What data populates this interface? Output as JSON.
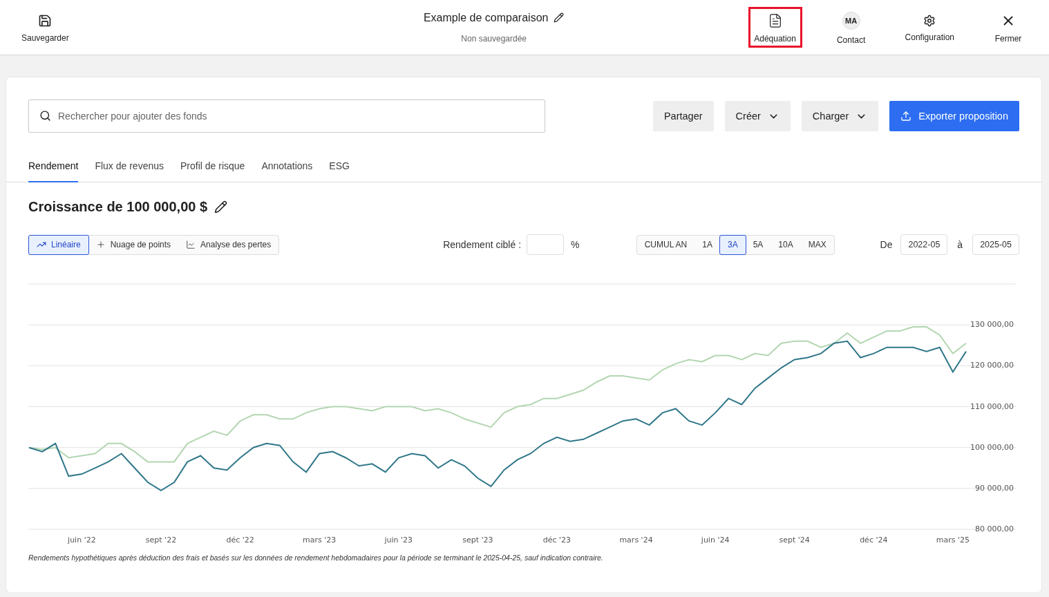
{
  "header": {
    "save": {
      "label": "Sauvegarder"
    },
    "title": "Example de comparaison",
    "status": "Non sauvegardée",
    "actions": [
      {
        "kind": "document",
        "label": "Adéquation",
        "highlighted": true
      },
      {
        "kind": "avatar",
        "initials": "MA",
        "label": "Contact",
        "highlighted": false
      },
      {
        "kind": "gear",
        "label": "Configuration",
        "highlighted": false
      },
      {
        "kind": "close",
        "label": "Fermer",
        "highlighted": false
      }
    ]
  },
  "toolbar": {
    "search": {
      "placeholder": "Rechercher pour ajouter des fonds"
    },
    "buttons": [
      {
        "kind": "plain",
        "label": "Partager"
      },
      {
        "kind": "dropdown",
        "label": "Créer"
      },
      {
        "kind": "dropdown",
        "label": "Charger"
      },
      {
        "kind": "primary",
        "label": "Exporter proposition"
      }
    ]
  },
  "tabs": [
    {
      "label": "Rendement",
      "selected": true
    },
    {
      "label": "Flux de revenus",
      "selected": false
    },
    {
      "label": "Profil de risque",
      "selected": false
    },
    {
      "label": "Annotations",
      "selected": false
    },
    {
      "label": "ESG",
      "selected": false
    }
  ],
  "section_title": "Croissance de 100 000,00 $",
  "views": [
    {
      "kind": "line",
      "label": "Linéaire",
      "selected": true
    },
    {
      "kind": "scatter",
      "label": "Nuage de points",
      "selected": false
    },
    {
      "kind": "loss",
      "label": "Analyse des pertes",
      "selected": false
    }
  ],
  "target": {
    "label": "Rendement ciblé :",
    "unit": "%"
  },
  "periods": [
    {
      "label": "CUMUL AN",
      "selected": false
    },
    {
      "label": "1A",
      "selected": false
    },
    {
      "label": "3A",
      "selected": true
    },
    {
      "label": "5A",
      "selected": false
    },
    {
      "label": "10A",
      "selected": false
    },
    {
      "label": "MAX",
      "selected": false
    }
  ],
  "range": {
    "from_label": "De",
    "from": "2022-05",
    "to_label": "à",
    "to": "2025-05"
  },
  "chart_data": {
    "type": "line",
    "categories": [
      null,
      null,
      null,
      null,
      "juin '22",
      null,
      null,
      null,
      null,
      null,
      "sept '22",
      null,
      null,
      null,
      null,
      null,
      "déc '22",
      null,
      null,
      null,
      null,
      null,
      "mars '23",
      null,
      null,
      null,
      null,
      null,
      "juin '23",
      null,
      null,
      null,
      null,
      null,
      "sept '23",
      null,
      null,
      null,
      null,
      null,
      "déc '23",
      null,
      null,
      null,
      null,
      null,
      "mars '24",
      null,
      null,
      null,
      null,
      null,
      "juin '24",
      null,
      null,
      null,
      null,
      null,
      "sept '24",
      null,
      null,
      null,
      null,
      null,
      "déc '24",
      null,
      null,
      null,
      null,
      null,
      "mars '25",
      null
    ],
    "series": [
      {
        "color": "#b3d6b0",
        "values": [
          100000,
          99500,
          100000,
          97500,
          98000,
          98500,
          101000,
          101000,
          99000,
          96500,
          96500,
          96500,
          101000,
          102500,
          104000,
          103000,
          106500,
          108000,
          108000,
          107000,
          107000,
          108500,
          109500,
          110000,
          110000,
          109500,
          109000,
          110000,
          110000,
          110000,
          109000,
          109500,
          108500,
          107000,
          106000,
          105000,
          108500,
          110000,
          110500,
          112000,
          112000,
          113000,
          114000,
          116000,
          117500,
          117500,
          117000,
          116500,
          119000,
          120500,
          121500,
          121000,
          122500,
          122500,
          121500,
          123000,
          122500,
          125500,
          126000,
          126000,
          124500,
          125500,
          128000,
          125500,
          127000,
          128500,
          128500,
          129500,
          129500,
          127500,
          123000,
          125500
        ]
      },
      {
        "color": "#2f7789",
        "values": [
          100000,
          99000,
          101000,
          93000,
          93500,
          95000,
          96500,
          98500,
          95000,
          91500,
          89500,
          91500,
          96500,
          98000,
          95000,
          94500,
          97500,
          100000,
          101000,
          100500,
          96500,
          94000,
          98500,
          99000,
          97500,
          95500,
          96000,
          94000,
          97500,
          98500,
          98000,
          95000,
          97000,
          95500,
          92500,
          90500,
          94500,
          97000,
          98500,
          101000,
          102500,
          101500,
          102000,
          103500,
          105000,
          106500,
          107000,
          105500,
          108500,
          109500,
          106500,
          105500,
          108500,
          112000,
          110500,
          114500,
          117000,
          119500,
          121500,
          122000,
          123000,
          125500,
          126000,
          122000,
          123000,
          124500,
          124500,
          124500,
          123500,
          124500,
          118500,
          123500
        ]
      }
    ],
    "ylim": [
      80000,
      140000
    ],
    "grid": true,
    "yticks": [
      {
        "value": 80000,
        "label": "80 000,00"
      },
      {
        "value": 90000,
        "label": "90 000,00"
      },
      {
        "value": 100000,
        "label": "100 000,00"
      },
      {
        "value": 110000,
        "label": "110 000,00"
      },
      {
        "value": 120000,
        "label": "120 000,00"
      },
      {
        "value": 130000,
        "label": "130 000,00"
      }
    ]
  },
  "footnote": "Rendements hypothétiques après déduction des frais et basés sur les données de rendement hebdomadaires pour la période se terminant le 2025-04-25, sauf indication contraire."
}
